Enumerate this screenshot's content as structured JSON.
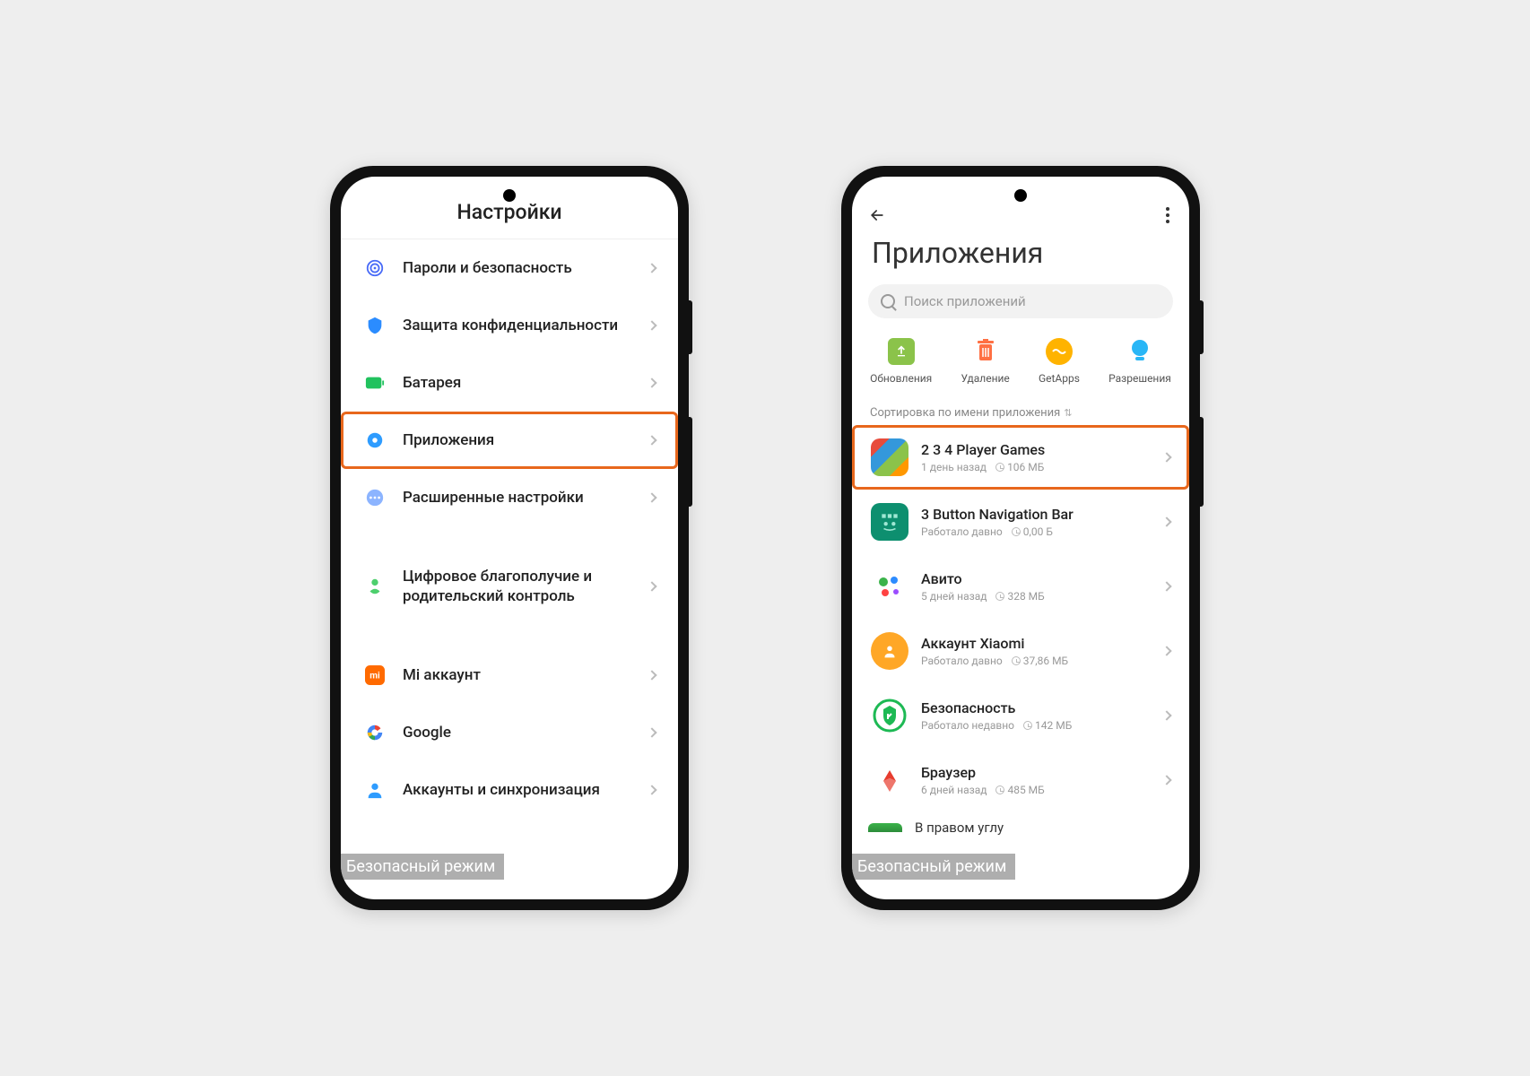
{
  "left": {
    "title": "Настройки",
    "items": [
      {
        "label": "Пароли и безопасность",
        "icon": "fingerprint",
        "color": "#4a6cf7"
      },
      {
        "label": "Защита конфиденциальности",
        "icon": "shield-blue",
        "color": "#2b8cff"
      },
      {
        "label": "Батарея",
        "icon": "battery",
        "color": "#21c25e"
      },
      {
        "label": "Приложения",
        "icon": "gear-blue",
        "color": "#2e9cff",
        "highlighted": true
      },
      {
        "label": "Расширенные настройки",
        "icon": "dots",
        "color": "#8cb4ff"
      }
    ],
    "items_group2": [
      {
        "label": "Цифровое благополучие и родительский контроль",
        "icon": "wellbeing",
        "color": "#4dcf6d"
      }
    ],
    "items_group3": [
      {
        "label": "Mi аккаунт",
        "icon": "mi",
        "color": "#ff6a00"
      },
      {
        "label": "Google",
        "icon": "google",
        "color": "#4285f4"
      },
      {
        "label": "Аккаунты и синхронизация",
        "icon": "account",
        "color": "#2e9cff"
      }
    ],
    "safemode": "Безопасный режим"
  },
  "right": {
    "title": "Приложения",
    "search_placeholder": "Поиск приложений",
    "actions": [
      {
        "label": "Обновления",
        "icon": "updates"
      },
      {
        "label": "Удаление",
        "icon": "delete"
      },
      {
        "label": "GetApps",
        "icon": "getapps"
      },
      {
        "label": "Разрешения",
        "icon": "permissions"
      }
    ],
    "sort_label": "Сортировка по имени приложения",
    "apps": [
      {
        "name": "2 3 4 Player Games",
        "time": "1 день назад",
        "size": "106 МБ",
        "icon_bg": "player-games",
        "highlighted": true
      },
      {
        "name": "3 Button Navigation Bar",
        "time": "Работало давно",
        "size": "0,00 Б",
        "icon_bg": "android-nav"
      },
      {
        "name": "Авито",
        "time": "5 дней назад",
        "size": "328 МБ",
        "icon_bg": "avito"
      },
      {
        "name": "Аккаунт Xiaomi",
        "time": "Работало давно",
        "size": "37,86 МБ",
        "icon_bg": "xiaomi"
      },
      {
        "name": "Безопасность",
        "time": "Работало недавно",
        "size": "142 МБ",
        "icon_bg": "security"
      },
      {
        "name": "Браузер",
        "time": "6 дней назад",
        "size": "485 МБ",
        "icon_bg": "yandex"
      }
    ],
    "partial_row": "В правом углу",
    "safemode": "Безопасный режим"
  }
}
